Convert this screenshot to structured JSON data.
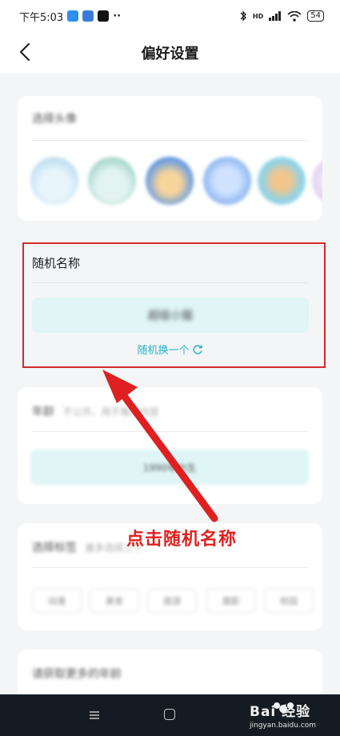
{
  "status_bar": {
    "time": "下午5:03",
    "more": "··",
    "battery": "54",
    "signal_label": "HD"
  },
  "nav": {
    "title": "偏好设置"
  },
  "avatar_card": {
    "title": "选择头像"
  },
  "random_name": {
    "label": "随机名称",
    "value": "超级小猫",
    "refresh": "随机换一个"
  },
  "card2": {
    "title": "年龄",
    "hint": "不公开，用于推荐内容",
    "box": "1990年出生"
  },
  "card3": {
    "title": "选择标签",
    "hint": "最多选择三个",
    "tags": [
      "动漫",
      "美食",
      "旅游",
      "摄影",
      "校园"
    ]
  },
  "card4": {
    "title": "请获取更多的年龄"
  },
  "annotation": {
    "text": "点击随机名称"
  },
  "watermark": {
    "text": "Bai 经验",
    "sub": "jingyan.baidu.com"
  },
  "colors": {
    "accent": "#26b3c9",
    "highlight": "#d42a2a",
    "annotation": "#e02020"
  }
}
